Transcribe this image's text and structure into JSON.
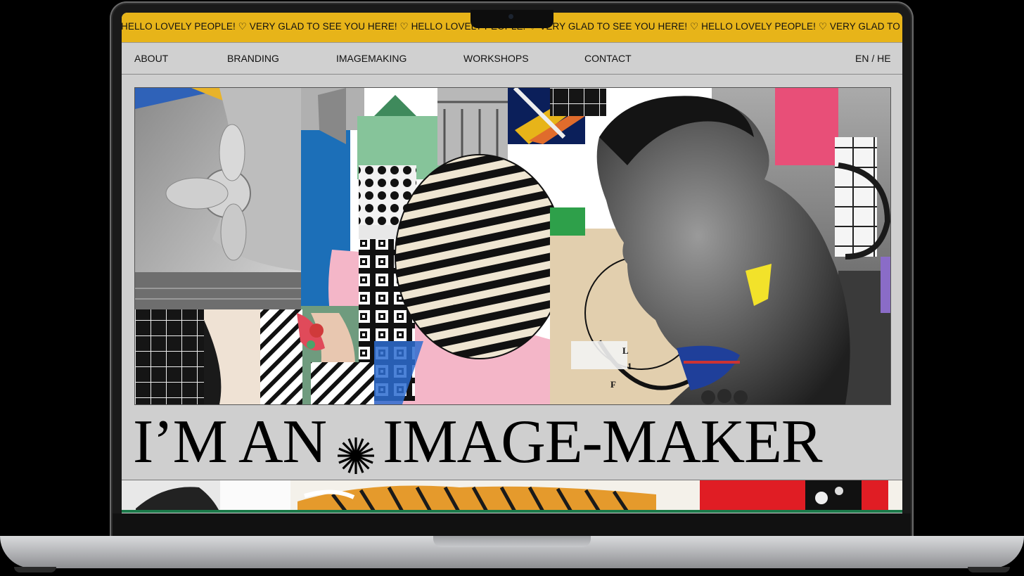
{
  "marquee": {
    "text": "HELLO LOVELY PEOPLE! ♡ VERY GLAD TO SEE YOU HERE! ♡ HELLO LOVELY PEOPLE! ♡ VERY GLAD TO SEE YOU HERE! ♡ HELLO LOVELY PEOPLE! ♡ VERY GLAD TO SEE YOU HERE! ♡"
  },
  "nav": {
    "items": [
      {
        "label": "ABOUT"
      },
      {
        "label": "BRANDING"
      },
      {
        "label": "IMAGEMAKING"
      },
      {
        "label": "WORKSHOPS"
      },
      {
        "label": "CONTACT"
      }
    ],
    "language": "EN / HE"
  },
  "hero": {
    "headline_part1": "I’M AN",
    "headline_part2": "IMAGE-MAKER",
    "collage_letters": [
      "L",
      "1",
      "F"
    ]
  },
  "colors": {
    "marquee_bg": "#e7b419",
    "page_bg": "#cfcfcf",
    "text": "#111111"
  }
}
